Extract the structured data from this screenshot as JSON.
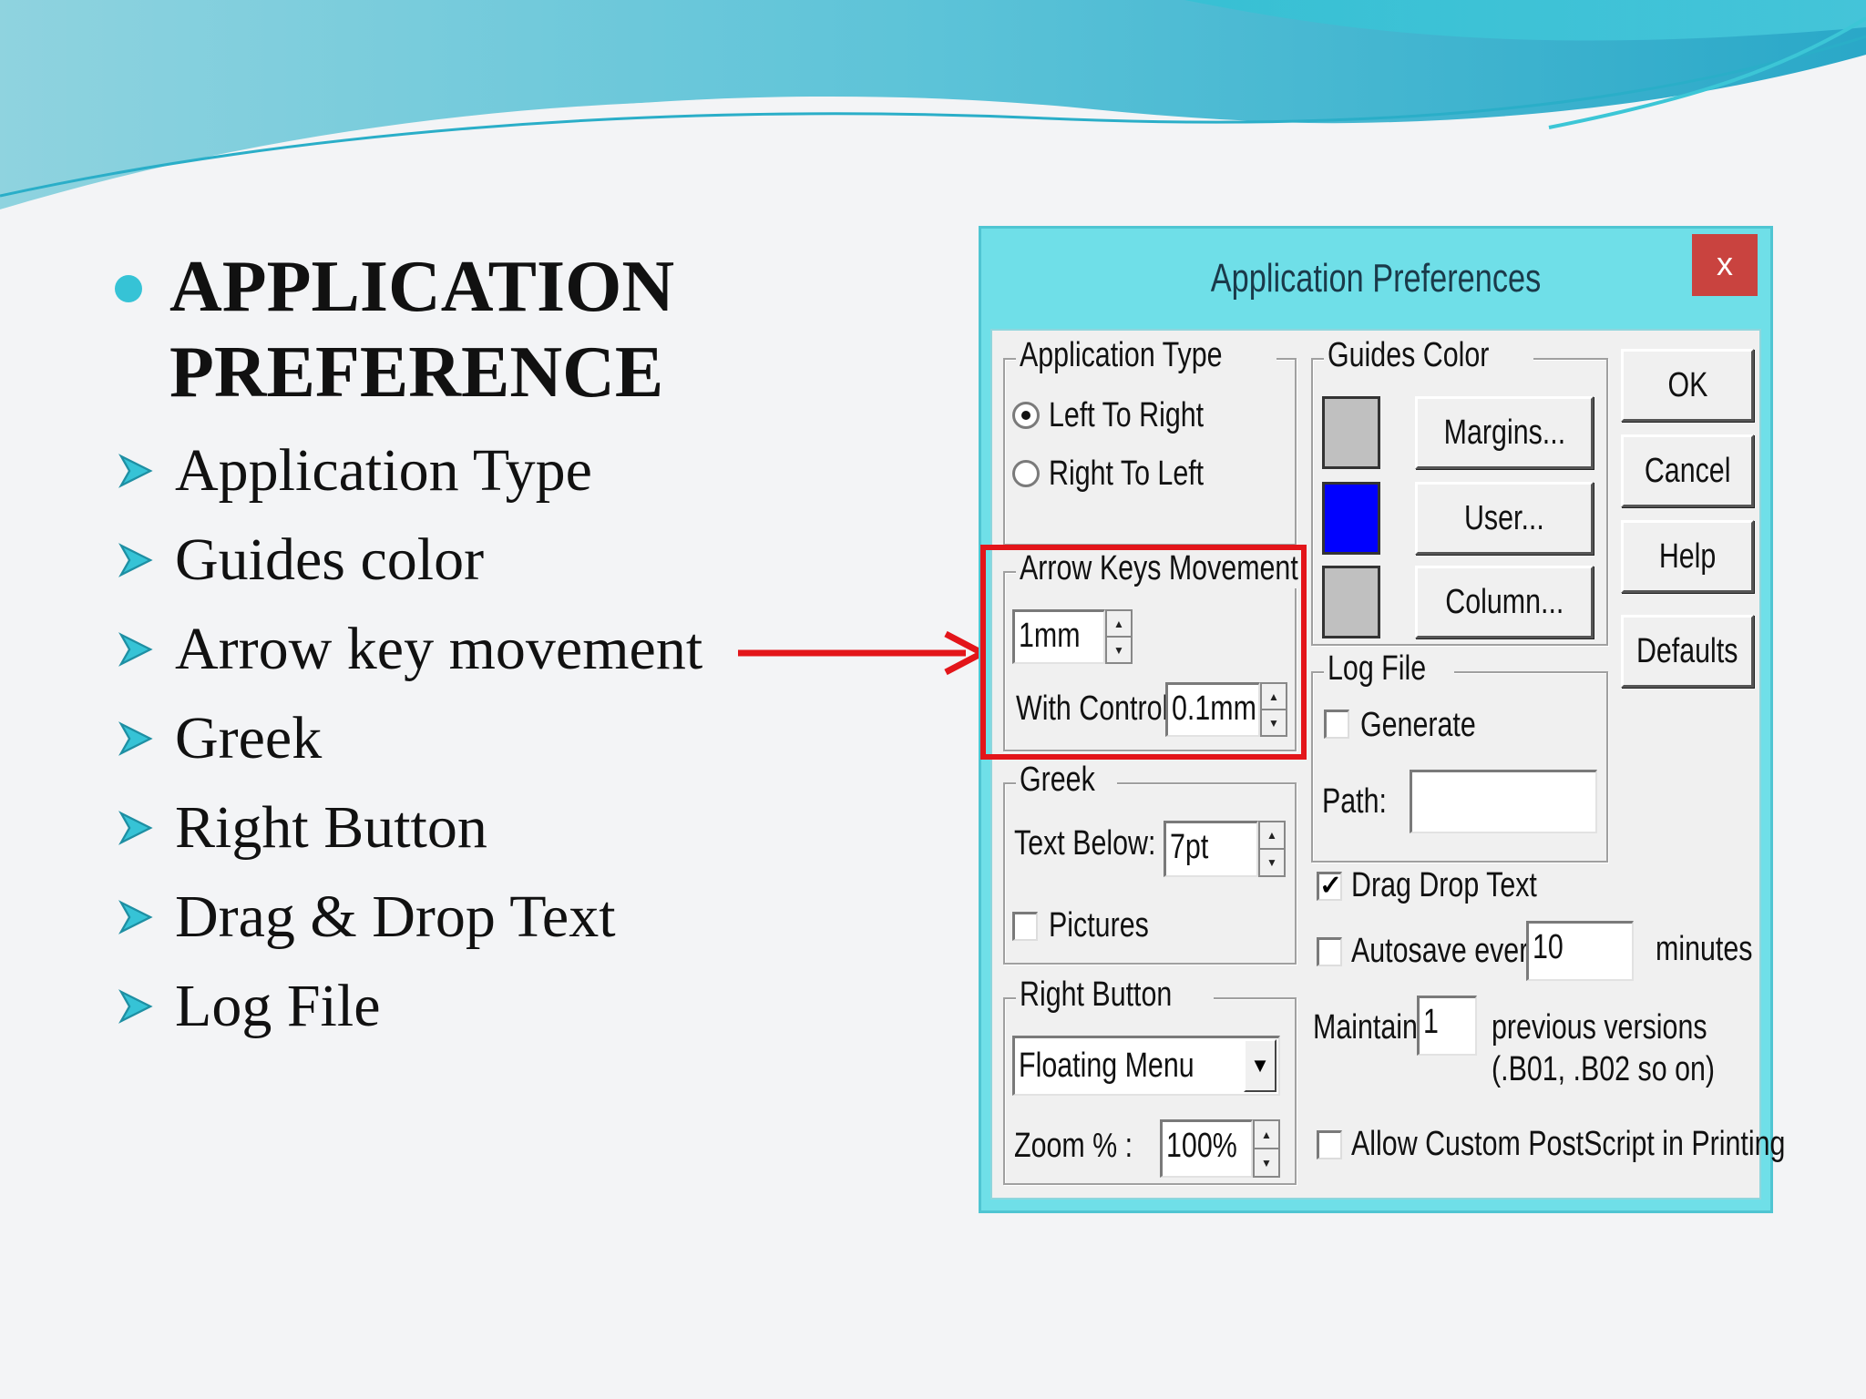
{
  "slide": {
    "heading": "APPLICATION PREFERENCE",
    "bullets": [
      "Application Type",
      "Guides color",
      "Arrow key movement",
      "Greek",
      "Right Button",
      "Drag & Drop Text",
      "Log File"
    ],
    "colors": {
      "accent": "#36c3d6",
      "pointer": "#e3151a"
    }
  },
  "dialog": {
    "title": "Application Preferences",
    "close_label": "x",
    "buttons": {
      "ok": "OK",
      "cancel": "Cancel",
      "help": "Help",
      "defaults": "Defaults"
    },
    "application_type": {
      "title": "Application Type",
      "options": [
        "Left To Right",
        "Right To Left"
      ],
      "selected": "Left To Right"
    },
    "guides_color": {
      "title": "Guides Color",
      "margins_label": "Margins...",
      "user_label": "User...",
      "column_label": "Column...",
      "swatch_colors": [
        "#c0c0c0",
        "#0000ff",
        "#c0c0c0"
      ]
    },
    "arrow_keys": {
      "title": "Arrow Keys Movement",
      "value": "1mm",
      "with_control_label": "With Control:",
      "with_control_value": "0.1mm"
    },
    "log_file": {
      "title": "Log File",
      "generate_label": "Generate",
      "generate_checked": false,
      "path_label": "Path:",
      "path_value": ""
    },
    "greek": {
      "title": "Greek",
      "text_below_label": "Text Below:",
      "text_below_value": "7pt",
      "pictures_label": "Pictures",
      "pictures_checked": false
    },
    "drag_drop": {
      "label": "Drag Drop Text",
      "checked": true
    },
    "autosave": {
      "label": "Autosave every:",
      "value": "10",
      "unit": "minutes",
      "checked": false
    },
    "maintain": {
      "label": "Maintain",
      "value": "1",
      "suffix_line1": "previous versions",
      "suffix_line2": "(.B01, .B02 so on)"
    },
    "right_button": {
      "title": "Right Button",
      "selected": "Floating Menu",
      "zoom_label": "Zoom % :",
      "zoom_value": "100%"
    },
    "allow_postscript": {
      "label": "Allow Custom PostScript in Printing",
      "checked": false
    }
  }
}
